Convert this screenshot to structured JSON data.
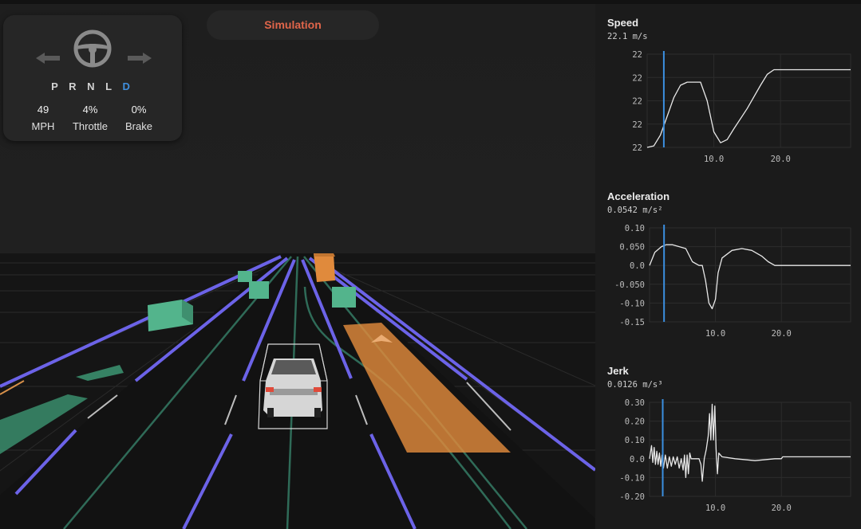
{
  "hud": {
    "gears": [
      "P",
      "R",
      "N",
      "L",
      "D"
    ],
    "active_gear": "D",
    "speed_value": "49",
    "speed_label": "MPH",
    "throttle_value": "4%",
    "throttle_label": "Throttle",
    "brake_value": "0%",
    "brake_label": "Brake",
    "icons": [
      "turn-left-arrow-icon",
      "steering-wheel-icon",
      "turn-right-arrow-icon"
    ]
  },
  "mode_label": "Simulation",
  "colors": {
    "accent_blue": "#3f8fde",
    "mode_label": "#e0654a",
    "lane_marking": "#6c63e8",
    "obstacle_green": "#5cc49a",
    "obstacle_orange": "#e08a3c",
    "plot_line": "#e8e8e8",
    "cursor": "#3b8fe0"
  },
  "chart_data": [
    {
      "type": "line",
      "title": "Speed",
      "value_text": "22.1 m/s",
      "y_tick_labels": [
        "22",
        "22",
        "22",
        "22",
        "22"
      ],
      "x_tick_labels": [
        "10.0",
        "20.0"
      ],
      "x_ticks": [
        10,
        20
      ],
      "xlim": [
        0,
        30.5
      ],
      "ylim": [
        21.8,
        22.4
      ],
      "cursor_x": 2.5,
      "grid": true,
      "series": [
        {
          "values": [
            [
              0,
              21.8
            ],
            [
              1,
              21.81
            ],
            [
              2,
              21.88
            ],
            [
              3,
              22.0
            ],
            [
              4,
              22.12
            ],
            [
              5,
              22.2
            ],
            [
              6,
              22.22
            ],
            [
              8,
              22.22
            ],
            [
              9,
              22.1
            ],
            [
              10,
              21.9
            ],
            [
              11,
              21.83
            ],
            [
              12,
              21.85
            ],
            [
              13,
              21.92
            ],
            [
              15,
              22.05
            ],
            [
              17,
              22.2
            ],
            [
              18,
              22.27
            ],
            [
              19,
              22.3
            ],
            [
              21,
              22.3
            ],
            [
              24,
              22.3
            ],
            [
              27,
              22.3
            ],
            [
              30.5,
              22.3
            ]
          ]
        }
      ]
    },
    {
      "type": "line",
      "title": "Acceleration",
      "value_text": "0.0542 m/s²",
      "y_tick_labels": [
        "0.10",
        "0.050",
        "0.0",
        "-0.050",
        "-0.10",
        "-0.15"
      ],
      "y_ticks": [
        0.1,
        0.05,
        0.0,
        -0.05,
        -0.1,
        -0.15
      ],
      "x_tick_labels": [
        "10.0",
        "20.0"
      ],
      "x_ticks": [
        10,
        20
      ],
      "xlim": [
        0,
        30.5
      ],
      "ylim": [
        -0.15,
        0.1
      ],
      "cursor_x": 2.2,
      "grid": true,
      "series": [
        {
          "values": [
            [
              0,
              0.0
            ],
            [
              0.8,
              0.035
            ],
            [
              1.8,
              0.05
            ],
            [
              2.5,
              0.055
            ],
            [
              3.5,
              0.055
            ],
            [
              4.5,
              0.05
            ],
            [
              5.5,
              0.045
            ],
            [
              6.5,
              0.01
            ],
            [
              7.5,
              0.0
            ],
            [
              8,
              0.0
            ],
            [
              8.5,
              -0.04
            ],
            [
              9.0,
              -0.1
            ],
            [
              9.5,
              -0.115
            ],
            [
              10.0,
              -0.09
            ],
            [
              10.4,
              -0.02
            ],
            [
              11,
              0.02
            ],
            [
              12.5,
              0.04
            ],
            [
              14,
              0.045
            ],
            [
              15.5,
              0.04
            ],
            [
              17,
              0.025
            ],
            [
              18,
              0.01
            ],
            [
              19,
              0.0
            ],
            [
              22,
              0.0
            ],
            [
              26,
              0.0
            ],
            [
              30.5,
              0.0
            ]
          ]
        }
      ]
    },
    {
      "type": "line",
      "title": "Jerk",
      "value_text": "0.0126 m/s³",
      "y_tick_labels": [
        "0.30",
        "0.20",
        "0.10",
        "0.0",
        "-0.10",
        "-0.20"
      ],
      "y_ticks": [
        0.3,
        0.2,
        0.1,
        0.0,
        -0.1,
        -0.2
      ],
      "x_tick_labels": [
        "10.0",
        "20.0"
      ],
      "x_ticks": [
        10,
        20
      ],
      "xlim": [
        0,
        30.5
      ],
      "ylim": [
        -0.2,
        0.3
      ],
      "cursor_x": 2.0,
      "grid": true,
      "series": [
        {
          "values": [
            [
              0,
              0.0
            ],
            [
              0.3,
              0.07
            ],
            [
              0.5,
              -0.02
            ],
            [
              0.7,
              0.06
            ],
            [
              0.9,
              -0.03
            ],
            [
              1.1,
              0.04
            ],
            [
              1.3,
              -0.03
            ],
            [
              1.5,
              0.03
            ],
            [
              1.7,
              -0.04
            ],
            [
              1.9,
              0.02
            ],
            [
              2.1,
              -0.05
            ],
            [
              2.4,
              0.02
            ],
            [
              2.7,
              -0.05
            ],
            [
              3.0,
              0.01
            ],
            [
              3.3,
              -0.04
            ],
            [
              3.6,
              0.01
            ],
            [
              3.9,
              -0.03
            ],
            [
              4.2,
              0.01
            ],
            [
              4.5,
              -0.05
            ],
            [
              4.8,
              0.0
            ],
            [
              5.1,
              -0.06
            ],
            [
              5.3,
              0.02
            ],
            [
              5.5,
              -0.1
            ],
            [
              5.7,
              0.02
            ],
            [
              5.9,
              -0.08
            ],
            [
              6.1,
              0.03
            ],
            [
              6.3,
              0.0
            ],
            [
              7.5,
              0.0
            ],
            [
              7.8,
              -0.03
            ],
            [
              8.0,
              -0.12
            ],
            [
              8.3,
              0.0
            ],
            [
              8.6,
              0.05
            ],
            [
              8.9,
              0.12
            ],
            [
              9.1,
              0.24
            ],
            [
              9.3,
              0.1
            ],
            [
              9.5,
              0.29
            ],
            [
              9.7,
              0.1
            ],
            [
              9.9,
              0.28
            ],
            [
              10.1,
              0.05
            ],
            [
              10.3,
              -0.08
            ],
            [
              10.5,
              0.03
            ],
            [
              11,
              0.01
            ],
            [
              13,
              0.0
            ],
            [
              16,
              -0.01
            ],
            [
              19,
              0.0
            ],
            [
              20,
              0.0
            ],
            [
              20.2,
              0.01
            ],
            [
              25,
              0.01
            ],
            [
              30.5,
              0.01
            ]
          ]
        }
      ]
    }
  ]
}
